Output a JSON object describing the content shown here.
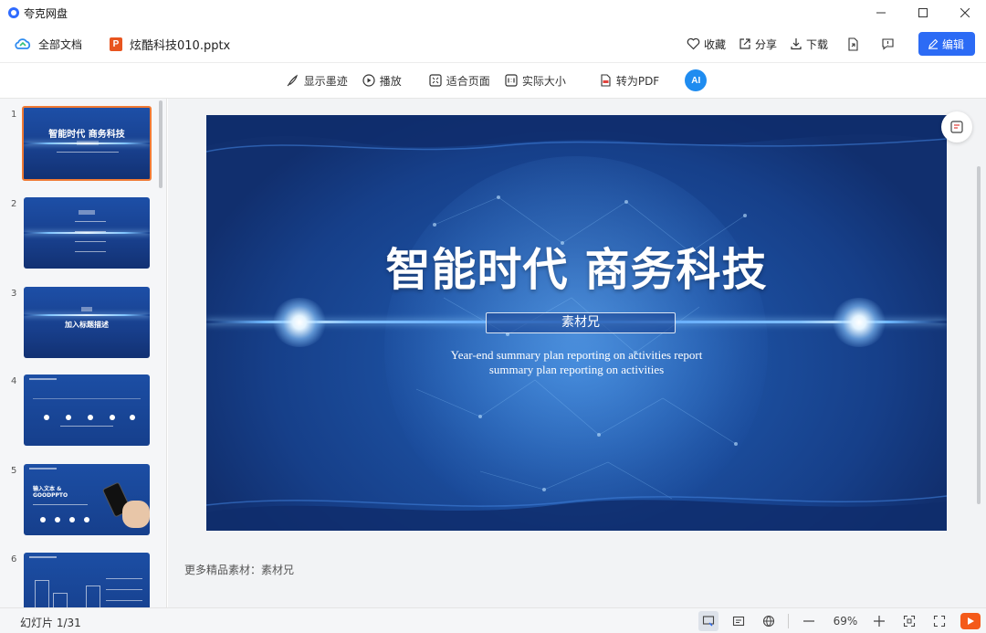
{
  "app": {
    "name": "夸克网盘"
  },
  "window_controls": {
    "minimize": "—",
    "maximize": "☐",
    "close": "✕"
  },
  "header": {
    "all_docs_label": "全部文档",
    "file_icon_letter": "P",
    "file_name": "炫酷科技010.pptx",
    "actions": {
      "favorite": "收藏",
      "share": "分享",
      "download": "下载",
      "edit": "编辑"
    }
  },
  "toolbar": {
    "show_ink": "显示墨迹",
    "play": "播放",
    "fit_page": "适合页面",
    "actual_size": "实际大小",
    "to_pdf": "转为PDF",
    "ai_label": "AI"
  },
  "thumbnails": [
    {
      "number": "1",
      "title": "智能时代 商务科技"
    },
    {
      "number": "2",
      "title": ""
    },
    {
      "number": "3",
      "title": "加入标题描述"
    },
    {
      "number": "4",
      "title": ""
    },
    {
      "number": "5",
      "title": "输入文本 & GOODPPTO"
    },
    {
      "number": "6",
      "title": ""
    }
  ],
  "slide": {
    "title": "智能时代 商务科技",
    "tag": "素材兄",
    "subtitle_line1": "Year-end summary plan reporting on activities report",
    "subtitle_line2": "summary plan reporting on activities"
  },
  "footer_note": "更多精品素材：素材兄",
  "status": {
    "slide_count": "幻灯片 1/31",
    "zoom": "69%"
  },
  "colors": {
    "accent": "#2c6bf5",
    "active_thumb_border": "#f07a34",
    "play": "#f45a1a"
  }
}
